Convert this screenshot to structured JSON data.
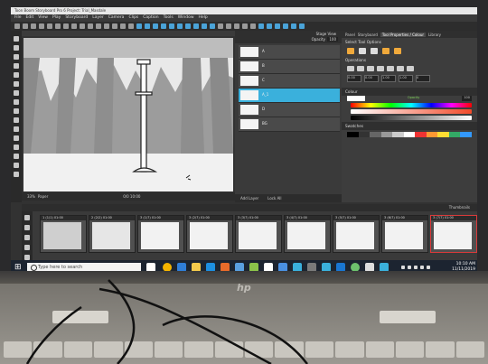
{
  "app": {
    "title": "Toon Boom Storyboard Pro 6 Project: Trial_Masdale",
    "menu": [
      "File",
      "Edit",
      "View",
      "Play",
      "Storyboard",
      "Layer",
      "Camera",
      "Clips",
      "Caption",
      "Tools",
      "Window",
      "Help"
    ]
  },
  "stage_panel": {
    "title": "Stage View",
    "opacity_label": "Opacity",
    "opacity_value": "100"
  },
  "layers": [
    {
      "label": "A"
    },
    {
      "label": "B"
    },
    {
      "label": "C"
    },
    {
      "label": "A_1"
    },
    {
      "label": "D"
    },
    {
      "label": "BG"
    }
  ],
  "stage_footer": {
    "left": "Add Layer",
    "right": "Lock All"
  },
  "viewer_footer": {
    "zoom": "33%",
    "mode": "Paper",
    "pos": "0/0 10:00"
  },
  "tool_properties": {
    "tabs": [
      "Panel",
      "Storyboard",
      "Tool Properties / Colour",
      "Library"
    ],
    "active_tab": "Tool Properties / Colour",
    "select_tool_label": "Select Tool Options",
    "operations_label": "Operations",
    "fields": [
      "0.00",
      "0.00",
      "1.00",
      "1.00",
      "0"
    ]
  },
  "colour": {
    "label": "Colour",
    "opacity_label": "Opacity",
    "opacity_value": "100",
    "swatches_label": "Swatches",
    "accent": "#3ab0dc"
  },
  "thumbnails": {
    "label": "Thumbnails",
    "panels": [
      "1 (1/1) 01:00",
      "2 (2/2) 01:00",
      "3 (1/7) 01:00",
      "3 (2/7) 01:00",
      "3 (3/7) 01:00",
      "3 (4/7) 01:00",
      "3 (5/7) 01:00",
      "3 (6/7) 01:00",
      "3 (7/7) 01:00"
    ]
  },
  "taskbar": {
    "search_placeholder": "Type here to search",
    "time": "10:10 AM",
    "date": "11/11/2019"
  },
  "brand": {
    "laptop_logo": "hp"
  }
}
